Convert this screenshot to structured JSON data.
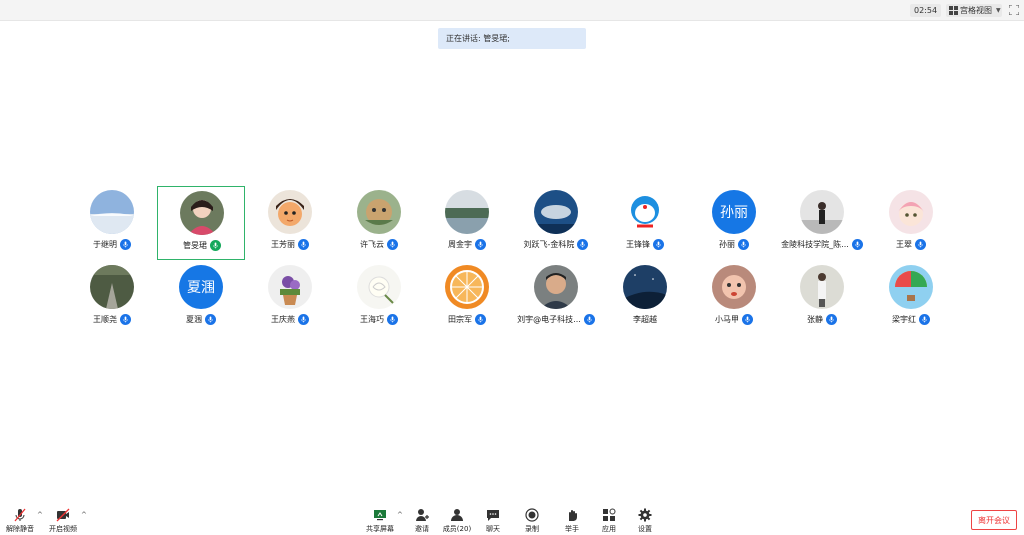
{
  "topbar": {
    "timer": "02:54",
    "view_mode": "宫格视图"
  },
  "speaker_banner": "正在讲话: 管旻珺;",
  "participants": [
    {
      "name": "于继明",
      "avatar": "sky-photo"
    },
    {
      "name": "管旻珺",
      "avatar": "girl-photo",
      "active": true,
      "mic_color": "#15a85b"
    },
    {
      "name": "王芳丽",
      "avatar": "cartoon-girl"
    },
    {
      "name": "许飞云",
      "avatar": "cartoon-art"
    },
    {
      "name": "周金宇",
      "avatar": "lake-photo"
    },
    {
      "name": "刘跃飞-金科院",
      "avatar": "whale-photo"
    },
    {
      "name": "王锋锋",
      "avatar": "doraemon"
    },
    {
      "name": "孙丽",
      "avatar_text": "孙丽"
    },
    {
      "name": "金陵科技学院_陈...",
      "avatar": "person-photo"
    },
    {
      "name": "王翠",
      "avatar": "cartoon-pink"
    },
    {
      "name": "王顺尧",
      "avatar": "forest-road"
    },
    {
      "name": "夏涠",
      "avatar_text": "夏涠"
    },
    {
      "name": "王庆燕",
      "avatar": "flower-pot"
    },
    {
      "name": "王海巧",
      "avatar": "white-rose"
    },
    {
      "name": "田宗军",
      "avatar": "orange-slice"
    },
    {
      "name": "刘宇@电子科技...",
      "avatar": "man-photo"
    },
    {
      "name": "李超越",
      "avatar": "night-sky",
      "no_mic": true
    },
    {
      "name": "小马甲",
      "avatar": "kid-photo"
    },
    {
      "name": "张静",
      "avatar": "woman-photo"
    },
    {
      "name": "梁宇红",
      "avatar": "balloon"
    }
  ],
  "toolbar": {
    "unmute": "解除静音",
    "start_video": "开启视频",
    "share_screen": "共享屏幕",
    "invite": "邀请",
    "members": "成员(20)",
    "chat": "聊天",
    "record": "录制",
    "raise_hand": "举手",
    "apps": "应用",
    "settings": "设置",
    "leave": "离开会议"
  },
  "colors": {
    "mic_blue": "#1a73e8",
    "active_border": "#2fb36a",
    "banner_bg": "#dde9f9",
    "leave_red": "#e33333"
  }
}
